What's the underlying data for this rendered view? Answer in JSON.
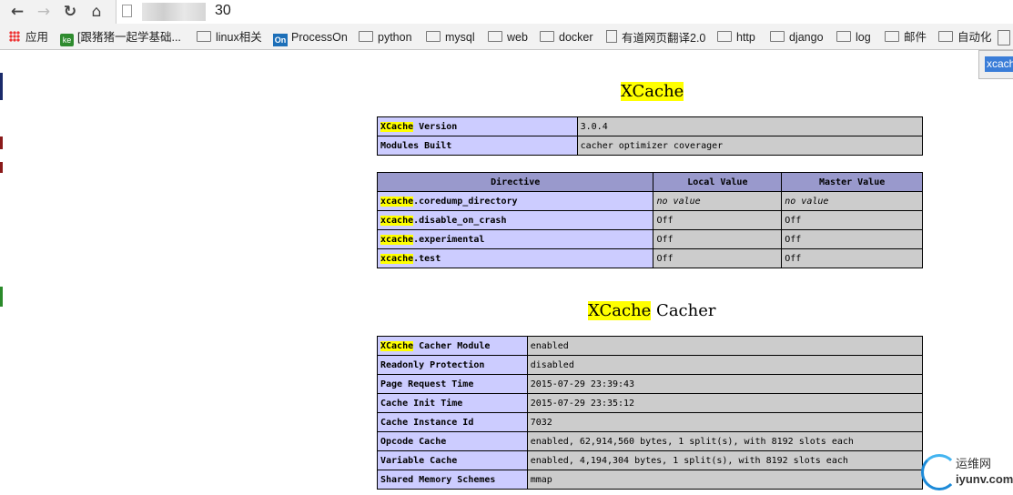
{
  "browser": {
    "url_suffix": "30",
    "bookmarks": [
      {
        "label": "应用",
        "icon": "apps-grid-icon"
      },
      {
        "label": "[跟猪猪一起学基础...",
        "icon": "ke-site-icon"
      },
      {
        "label": "linux相关",
        "icon": "folder-icon"
      },
      {
        "label": "ProcessOn",
        "icon": "processon-icon"
      },
      {
        "label": "python",
        "icon": "folder-icon"
      },
      {
        "label": "mysql",
        "icon": "folder-icon"
      },
      {
        "label": "web",
        "icon": "folder-icon"
      },
      {
        "label": "docker",
        "icon": "folder-icon"
      },
      {
        "label": "有道网页翻译2.0",
        "icon": "page-icon"
      },
      {
        "label": "http",
        "icon": "folder-icon"
      },
      {
        "label": "django",
        "icon": "folder-icon"
      },
      {
        "label": "log",
        "icon": "folder-icon"
      },
      {
        "label": "邮件",
        "icon": "folder-icon"
      },
      {
        "label": "自动化",
        "icon": "folder-icon"
      }
    ],
    "find_highlight": "xcach",
    "colors": {
      "header_bg": "#9999cc",
      "key_bg": "#ccccff",
      "value_bg": "#cccccc",
      "highlight": "#ffff00"
    }
  },
  "page": {
    "section1": {
      "title": "XCache"
    },
    "info_table": [
      {
        "key_hl": "XCache",
        "key_rest": " Version",
        "value": "3.0.4"
      },
      {
        "key_hl": "",
        "key_rest": "Modules Built",
        "value": "cacher optimizer coverager"
      }
    ],
    "directive_table": {
      "headers": [
        "Directive",
        "Local Value",
        "Master Value"
      ],
      "rows": [
        {
          "hl": "xcache",
          "rest": ".coredump_directory",
          "local": "no value",
          "master": "no value",
          "italic": true
        },
        {
          "hl": "xcache",
          "rest": ".disable_on_crash",
          "local": "Off",
          "master": "Off",
          "italic": false
        },
        {
          "hl": "xcache",
          "rest": ".experimental",
          "local": "Off",
          "master": "Off",
          "italic": false
        },
        {
          "hl": "xcache",
          "rest": ".test",
          "local": "Off",
          "master": "Off",
          "italic": false
        }
      ]
    },
    "section2": {
      "title_hl": "XCache",
      "title_rest": " Cacher"
    },
    "cacher_table": [
      {
        "key_hl": "XCache",
        "key_rest": " Cacher Module",
        "value": "enabled"
      },
      {
        "key_hl": "",
        "key_rest": "Readonly Protection",
        "value": "disabled"
      },
      {
        "key_hl": "",
        "key_rest": "Page Request Time",
        "value": "2015-07-29 23:39:43"
      },
      {
        "key_hl": "",
        "key_rest": "Cache Init Time",
        "value": "2015-07-29 23:35:12"
      },
      {
        "key_hl": "",
        "key_rest": "Cache Instance Id",
        "value": "7032"
      },
      {
        "key_hl": "",
        "key_rest": "Opcode Cache",
        "value": "enabled, 62,914,560 bytes, 1 split(s), with 8192 slots each"
      },
      {
        "key_hl": "",
        "key_rest": "Variable Cache",
        "value": "enabled, 4,194,304 bytes, 1 split(s), with 8192 slots each"
      },
      {
        "key_hl": "",
        "key_rest": "Shared Memory Schemes",
        "value": "mmap"
      }
    ]
  },
  "watermark": {
    "line1": "运维网",
    "line2": "iyunv.com"
  }
}
